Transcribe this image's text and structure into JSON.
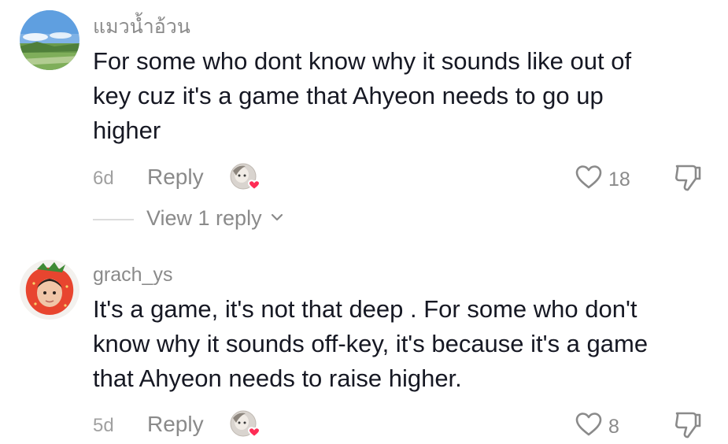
{
  "comments": [
    {
      "username": "แมวน้ำอ้วน",
      "text_lines": [
        "For some who dont know why it sounds like out of",
        "key cuz it's a game that Ahyeon needs to go up",
        "higher"
      ],
      "time": "6d",
      "reply_label": "Reply",
      "like_count": "18",
      "view_replies_label": "View 1 reply",
      "avatar_icon": "landscape-avatar",
      "creator_liked": true
    },
    {
      "username": "grach_ys",
      "text_lines": [
        "It's a game, it's not that deep . For some who don't",
        "know why it sounds off-key, it's because it's a game",
        "that Ahyeon needs to raise higher."
      ],
      "time": "5d",
      "reply_label": "Reply",
      "like_count": "8",
      "avatar_icon": "strawberry-avatar",
      "creator_liked": true
    }
  ],
  "colors": {
    "text_primary": "#161823",
    "text_secondary": "#8a8a8a",
    "heart_badge": "#fe2c55"
  }
}
